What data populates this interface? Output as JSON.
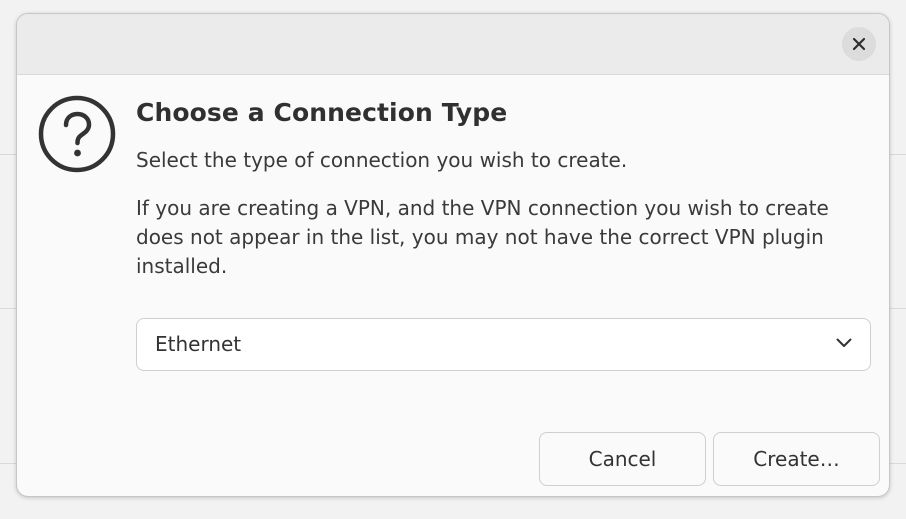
{
  "dialog": {
    "heading": "Choose a Connection Type",
    "subtext": "Select the type of connection you wish to create.",
    "info": "If you are creating a VPN, and the VPN connection you wish to create does not appear in the list, you may not have the correct VPN plugin installed.",
    "connection_type": {
      "selected": "Ethernet"
    },
    "buttons": {
      "cancel": "Cancel",
      "create": "Create…"
    }
  },
  "icons": {
    "close": "close-icon",
    "question": "question-icon",
    "dropdown": "chevron-down-icon"
  },
  "colors": {
    "text": "#303030",
    "titlebar": "#ebebeb",
    "dialog_bg": "#fafafa"
  }
}
